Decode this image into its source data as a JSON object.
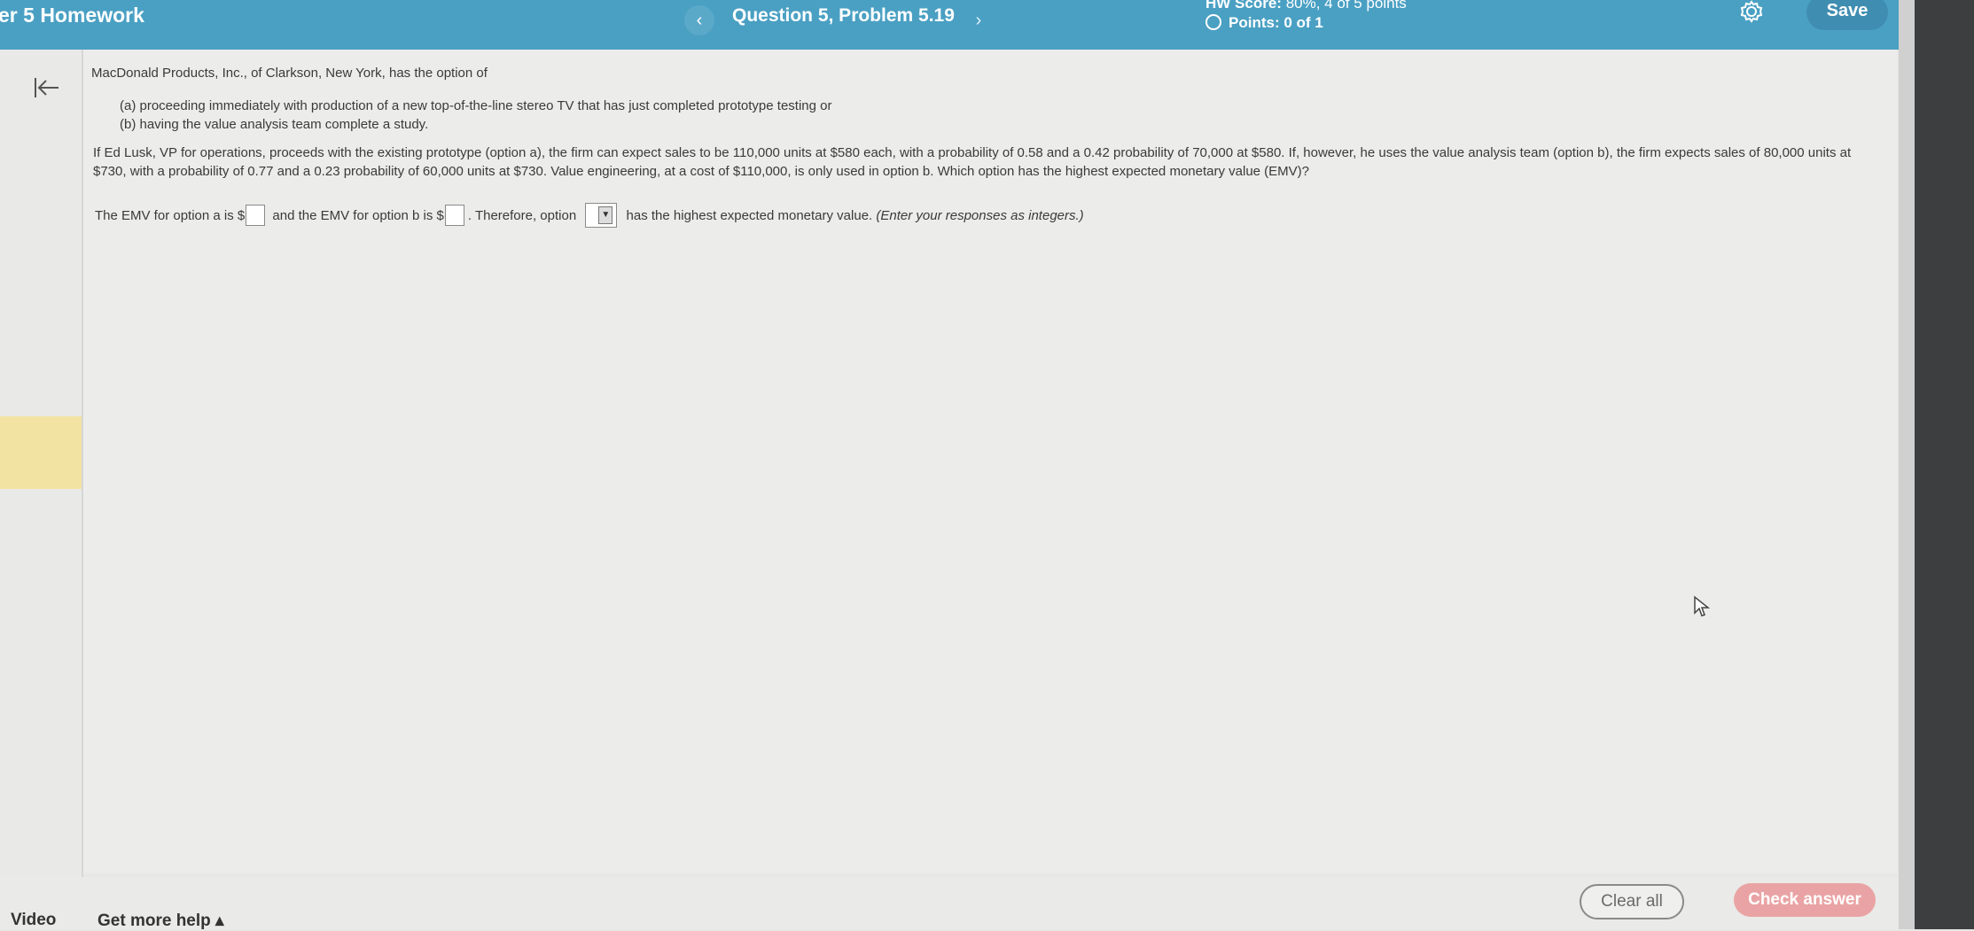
{
  "header": {
    "assignment_title": "er 5 Homework",
    "prev_label": "‹",
    "question_title": "Question 5, Problem 5.19",
    "next_label": "›",
    "hw_score_label": "HW Score:",
    "hw_score_value": "80%, 4 of 5 points",
    "points_text": "Points: 0 of 1",
    "save_label": "Save",
    "colors": {
      "bar": "#4aa0c3",
      "save": "#3f8db0"
    }
  },
  "sidebar": {
    "collapse_icon": "collapse-left-icon"
  },
  "problem": {
    "intro": "MacDonald Products, Inc., of Clarkson, New York, has the option of",
    "option_a": "(a) proceeding immediately with production of a new top-of-the-line stereo TV that has just completed prototype testing or",
    "option_b": "(b) having the value analysis team complete a study.",
    "body": "If Ed Lusk, VP for operations, proceeds with the existing prototype (option a), the firm can expect sales to be 110,000 units at $580 each, with a probability of 0.58 and a 0.42 probability of 70,000 at $580. If, however, he uses the value analysis team (option b), the firm expects sales of 80,000 units at $730, with a probability of 0.77 and a 0.23 probability of 60,000 units at $730. Value engineering, at a cost of $110,000, is only used in option b. Which option has the highest expected monetary value (EMV)?",
    "answer_part1": "The EMV for option a is $",
    "answer_part2": "and the EMV for option b is $",
    "answer_part3": ". Therefore, option",
    "answer_part4": "has the highest expected monetary value.",
    "answer_hint": "(Enter your responses as integers.)",
    "emv_a_value": "",
    "emv_b_value": "",
    "option_selected": "",
    "select_caret": "▼"
  },
  "footer": {
    "video_label": "Video",
    "help_label": "Get more help ▴",
    "clear_label": "Clear all",
    "check_label": "Check answer",
    "colors": {
      "check": "#eaa3a4"
    }
  }
}
